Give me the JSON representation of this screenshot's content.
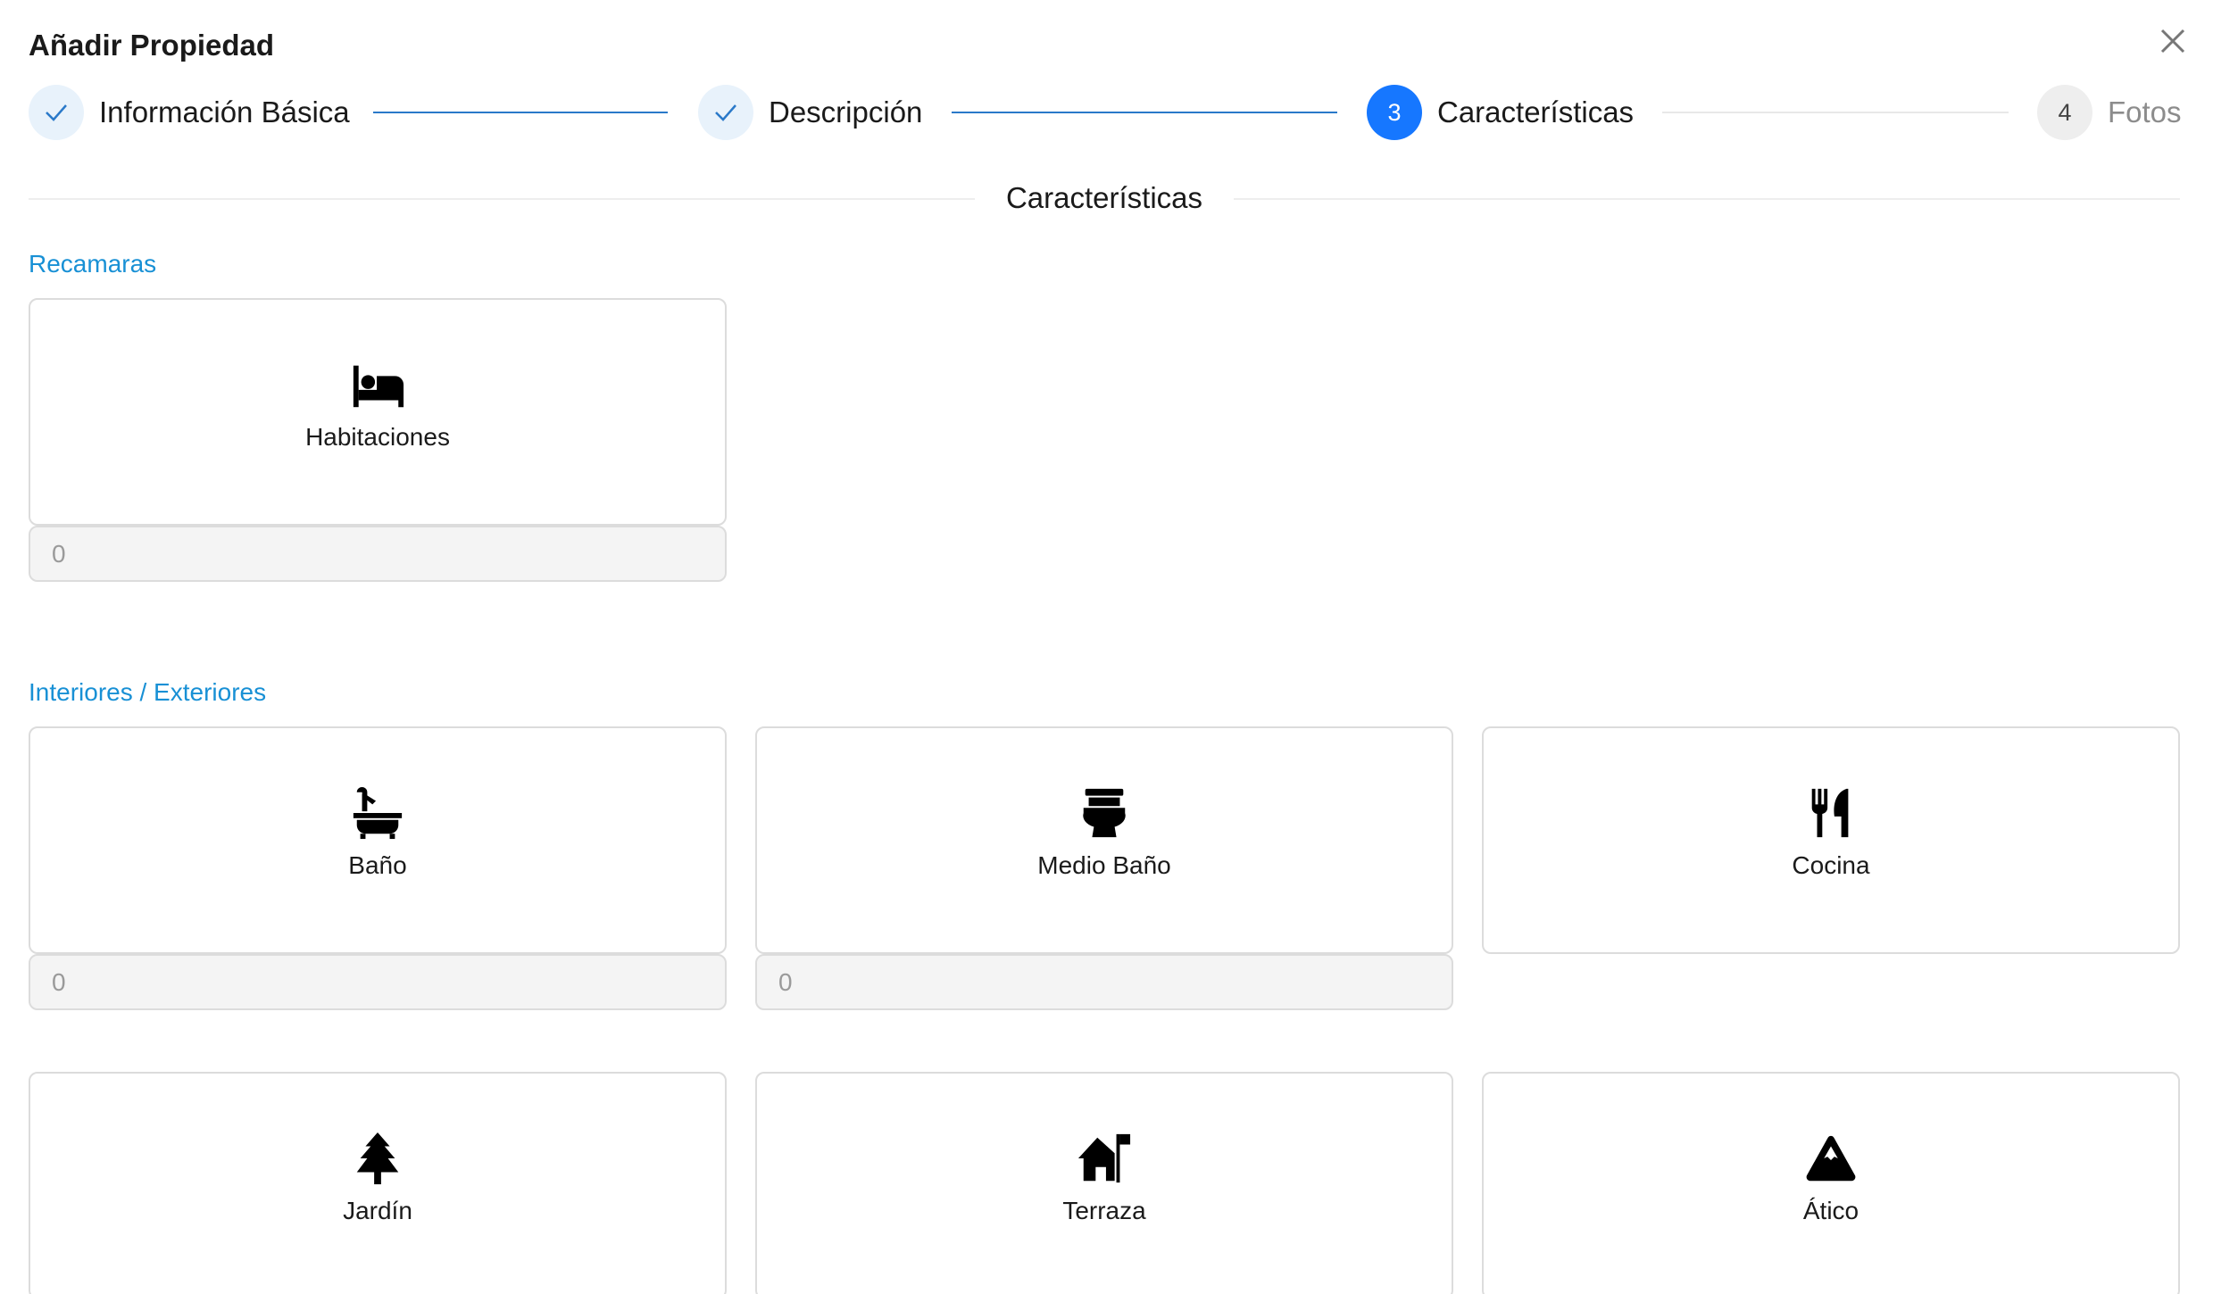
{
  "modal": {
    "title": "Añadir Propiedad"
  },
  "steps": [
    {
      "label": "Información Básica",
      "status": "done"
    },
    {
      "label": "Descripción",
      "status": "done"
    },
    {
      "number": "3",
      "label": "Características",
      "status": "active"
    },
    {
      "number": "4",
      "label": "Fotos",
      "status": "pending"
    }
  ],
  "section": {
    "title": "Características"
  },
  "groups": {
    "recamaras": {
      "label": "Recamaras",
      "cards": [
        {
          "label": "Habitaciones",
          "icon": "bed-icon",
          "count": "0"
        }
      ]
    },
    "interiores": {
      "label": "Interiores / Exteriores",
      "cards": [
        {
          "label": "Baño",
          "icon": "bath-icon",
          "count": "0"
        },
        {
          "label": "Medio Baño",
          "icon": "toilet-icon",
          "count": "0"
        },
        {
          "label": "Cocina",
          "icon": "utensils-icon"
        },
        {
          "label": "Jardín",
          "icon": "tree-icon"
        },
        {
          "label": "Terraza",
          "icon": "house-flag-icon"
        },
        {
          "label": "Ático",
          "icon": "mountain-icon"
        }
      ]
    }
  },
  "colors": {
    "accent": "#1677ff",
    "group_label": "#1890d5",
    "done_line": "#2a79c9"
  }
}
